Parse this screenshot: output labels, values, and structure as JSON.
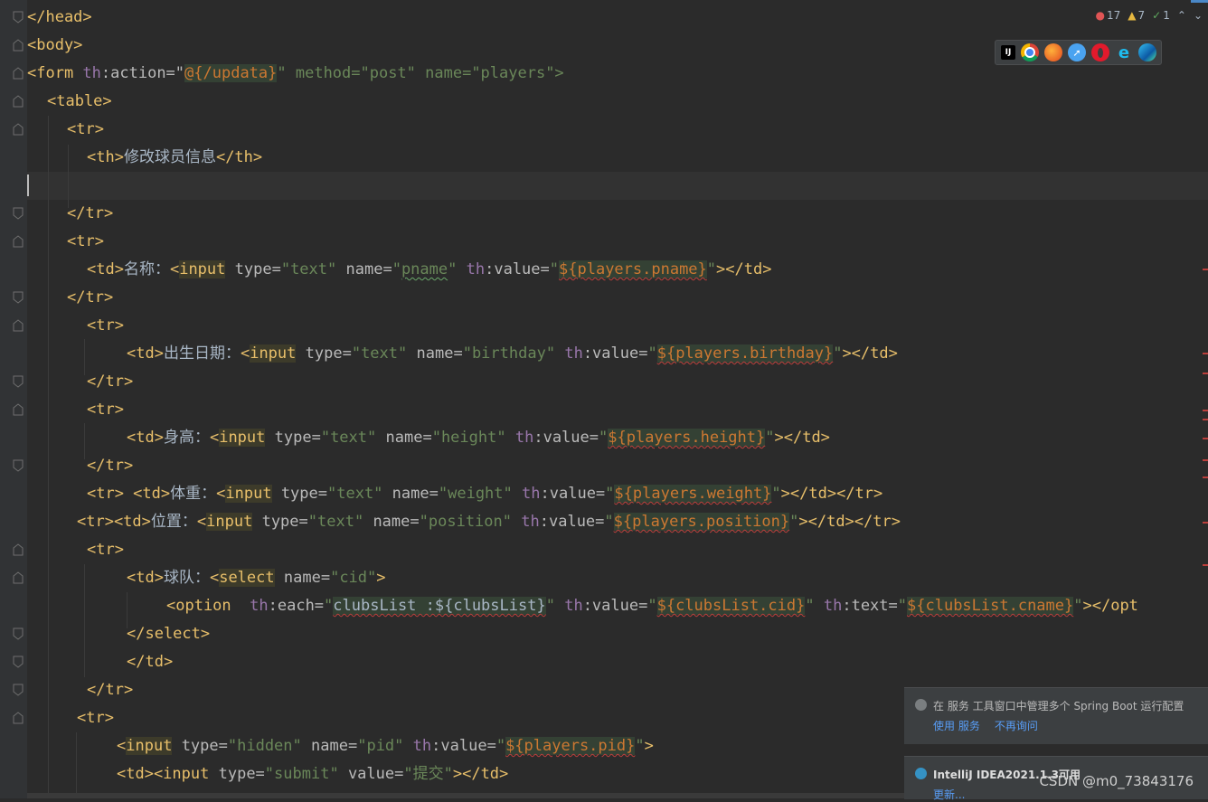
{
  "inspections": {
    "errors": "17",
    "warnings": "7",
    "weak_warnings": "1"
  },
  "browsers": [
    "IntelliJ",
    "Chrome",
    "Firefox",
    "Safari",
    "Opera",
    "Internet Explorer",
    "Edge"
  ],
  "code": {
    "l1": "</head>",
    "l2": "<body>",
    "l3_a": "<form ",
    "l3_ns": "th",
    "l3_b": ":action=\"",
    "l3_c": "@{/updata}",
    "l3_d": "\" method=\"post\" name=\"players\">",
    "l4": "<table>",
    "l5": "<tr>",
    "l6_a": "<th>",
    "l6_b": "修改球员信息",
    "l6_c": "</th>",
    "l8": "</tr>",
    "l9": "<tr>",
    "l10_label": "名称：",
    "l10_name": "pname",
    "l10_expr": "${players.pname}",
    "l11": "</tr>",
    "l12": "<tr>",
    "l13_label": "出生日期：",
    "l13_name": "birthday",
    "l13_expr": "${players.birthday}",
    "l14": "</tr>",
    "l15": "<tr>",
    "l16_label": "身高：",
    "l16_name": "height",
    "l16_expr": "${players.height}",
    "l17": "</tr>",
    "l18_label": "体重：",
    "l18_name": "weight",
    "l18_expr": "${players.weight}",
    "l19_label": "位置：",
    "l19_name": "position",
    "l19_expr": "${players.position}",
    "l20": "<tr>",
    "l21_label": "球队：",
    "l21_name": "cid",
    "l22_each": "clubsList :${clubsList}",
    "l22_val": "${clubsList.cid}",
    "l22_text": "${clubsList.cname}",
    "l23": "</select>",
    "l24": "</td>",
    "l25": "</tr>",
    "l26": "<tr>",
    "l27_name": "pid",
    "l27_expr": "${players.pid}",
    "l28_value": "提交"
  },
  "notifications": [
    {
      "title": "在 服务 工具窗口中管理多个 Spring Boot 运行配置",
      "links": [
        "使用 服务",
        "不再询问"
      ]
    },
    {
      "title": "IntelliJ IDEA2021.1.3可用",
      "links": [
        "更新..."
      ]
    }
  ],
  "watermark": "CSDN @m0_73843176"
}
